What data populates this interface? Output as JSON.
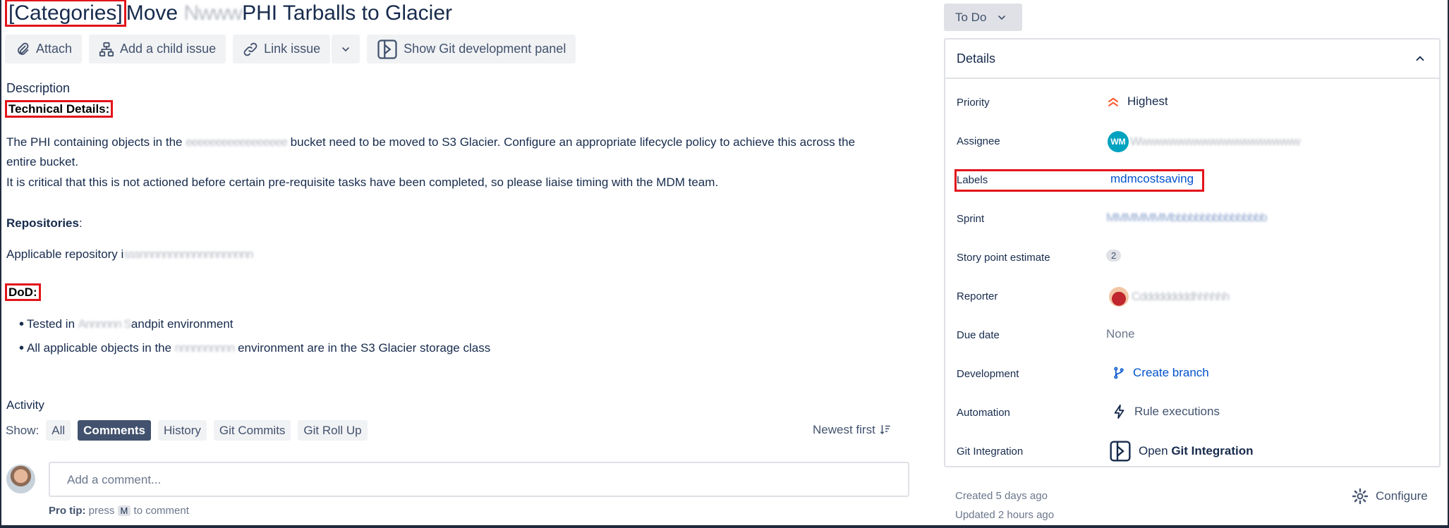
{
  "issue": {
    "title_tag": "[Categories]",
    "title_part1": "Move ",
    "title_redacted": "Nwww",
    "title_part2": "PHI Tarballs to Glacier"
  },
  "toolbar": {
    "attach": "Attach",
    "add_child": "Add a child issue",
    "link_issue": "Link issue",
    "git_panel": "Show Git development panel"
  },
  "description": {
    "heading": "Description",
    "technical_details": "Technical Details:",
    "p1_start": "The PHI containing objects in the ",
    "p1_redacted": "eeeeeeeeeeeeeeeee",
    "p1_end": " bucket need to be moved to S3 Glacier.  Configure an appropriate lifecycle policy to achieve this across the",
    "p1_cont": "entire bucket.",
    "p2": "It is critical that this is not actioned before certain pre-requisite tasks have been completed, so please liaise timing with the MDM team.",
    "repositories": "Repositories",
    "repo_colon": ":",
    "repo_line_start": "Applicable repository i",
    "repo_line_redacted": "sssnnnnnnnnnnnnnnnnnnn",
    "dod": "DoD:",
    "bullet1_start": "Tested in ",
    "bullet1_redacted": "Annnnnn S",
    "bullet1_end": "andpit environment",
    "bullet2_start": "All applicable objects in the ",
    "bullet2_redacted": "nnnnnnnnnn",
    "bullet2_end": " environment are in the S3 Glacier storage class"
  },
  "activity": {
    "heading": "Activity",
    "show_label": "Show:",
    "tabs": [
      "All",
      "Comments",
      "History",
      "Git Commits",
      "Git Roll Up"
    ],
    "active_tab": "Comments",
    "sort": "Newest first",
    "comment_placeholder": "Add a comment...",
    "protip_bold": "Pro tip:",
    "protip_press": " press ",
    "protip_key": "M",
    "protip_end": " to comment"
  },
  "status": {
    "label": "To Do"
  },
  "details": {
    "heading": "Details",
    "priority_label": "Priority",
    "priority_value": "Highest",
    "assignee_label": "Assignee",
    "assignee_initials": "WM",
    "assignee_redacted": "Wwwwwwwwwwwwwwwwwwwww",
    "labels_label": "Labels",
    "labels_value": "mdmcostsaving",
    "sprint_label": "Sprint",
    "sprint_redacted": "MMMMMMMbbbbbbbbbbbbbbbb",
    "story_points_label": "Story point estimate",
    "story_points_value": "2",
    "reporter_label": "Reporter",
    "reporter_redacted": "Cdddddddddhhhhhh",
    "due_date_label": "Due date",
    "due_date_value": "None",
    "development_label": "Development",
    "development_value": "Create branch",
    "automation_label": "Automation",
    "automation_value": "Rule executions",
    "git_label": "Git Integration",
    "git_value_prefix": "Open ",
    "git_value_bold": "Git Integration"
  },
  "footer": {
    "created": "Created 5 days ago",
    "updated": "Updated 2 hours ago",
    "configure": "Configure"
  },
  "colors": {
    "accent_red": "#e2141b",
    "link_blue": "#0052cc",
    "priority_orange": "#ff5630"
  }
}
